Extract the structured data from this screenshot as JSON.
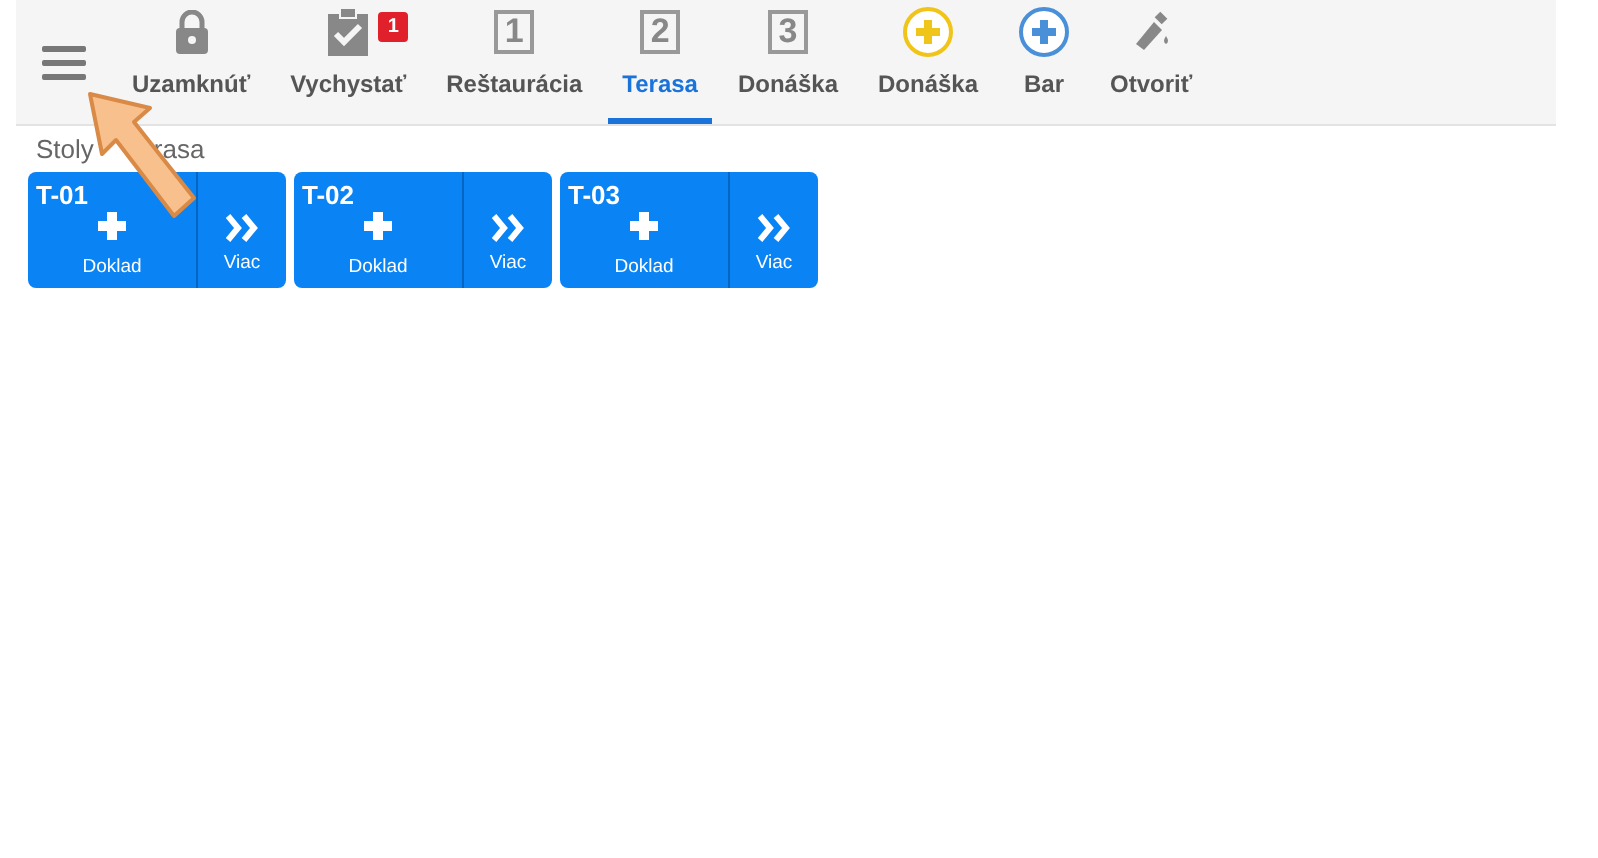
{
  "toolbar": {
    "items": [
      {
        "kind": "lock",
        "label": "Uzamknúť",
        "selected": false
      },
      {
        "kind": "clipboard",
        "label": "Vychystať",
        "badge": "1",
        "selected": false
      },
      {
        "kind": "number",
        "glyph": "1",
        "label": "Reštaurácia",
        "selected": false
      },
      {
        "kind": "number",
        "glyph": "2",
        "label": "Terasa",
        "selected": true
      },
      {
        "kind": "number",
        "glyph": "3",
        "label": "Donáška",
        "selected": false
      },
      {
        "kind": "plus",
        "color": "#f0c419",
        "label": "Donáška",
        "selected": false
      },
      {
        "kind": "plus",
        "color": "#4a90d9",
        "label": "Bar",
        "selected": false
      },
      {
        "kind": "bottle",
        "label": "Otvoriť",
        "selected": false
      }
    ]
  },
  "caption": [
    "Stoly",
    "rasa"
  ],
  "tables": [
    {
      "name": "T-01",
      "action": "Doklad",
      "more": "Viac"
    },
    {
      "name": "T-02",
      "action": "Doklad",
      "more": "Viac"
    },
    {
      "name": "T-03",
      "action": "Doklad",
      "more": "Viac"
    }
  ]
}
